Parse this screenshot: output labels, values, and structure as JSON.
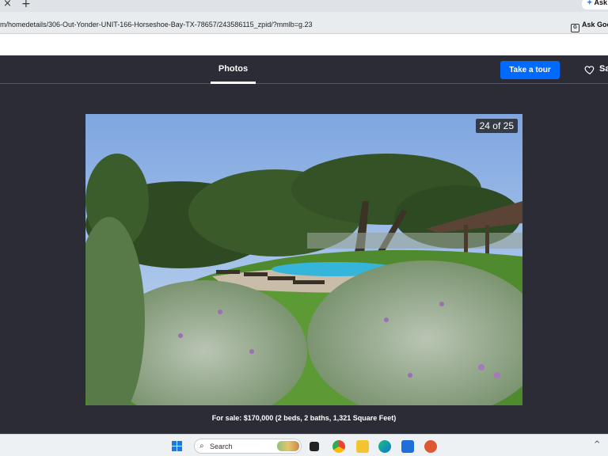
{
  "browser": {
    "tab_close_glyph": "×",
    "new_tab_glyph": "+",
    "ask_tab_label": "Ask",
    "url": "m/homedetails/306-Out-Yonder-UNIT-166-Horseshoe-Bay-TX-78657/243586115_zpid/?mmlb=g.23",
    "ask_google_label": "Ask Goo"
  },
  "header": {
    "photos_tab_label": "Photos",
    "tour_button_label": "Take a tour",
    "save_label": "Sa"
  },
  "gallery": {
    "counter": "24 of 25",
    "caption": "For sale: $170,000 (2 beds, 2 baths, 1,321 Square Feet)"
  },
  "taskbar": {
    "search_placeholder": "Search",
    "tray_chevron": "^",
    "icons": [
      "windows-start-icon",
      "file-explorer-icon",
      "chrome-icon",
      "folder-icon",
      "edge-icon",
      "store-icon",
      "duckduckgo-icon"
    ]
  },
  "colors": {
    "accent_button": "#006aff",
    "header_bg": "#2b2c35"
  }
}
